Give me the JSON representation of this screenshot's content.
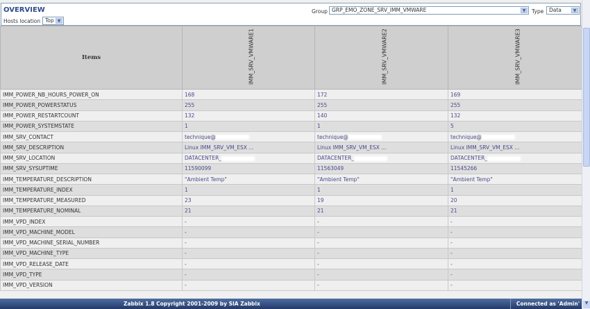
{
  "header": {
    "title": "OVERVIEW",
    "hosts_location_label": "Hosts location",
    "hosts_location_value": "Top",
    "group_label": "Group",
    "group_value": "GRP_EMO_ZONE_SRV_IMM_VMWARE",
    "type_label": "Type",
    "type_value": "Data"
  },
  "table": {
    "items_header": "Items",
    "hosts": [
      "IMM_SRV_VMWARE1",
      "IMM_SRV_VMWARE2",
      "IMM_SRV_VMWARE3"
    ],
    "rows": [
      {
        "item": "IMM_POWER_NB_HOURS_POWER_ON",
        "values": [
          "168",
          "172",
          "169"
        ]
      },
      {
        "item": "IMM_POWER_POWERSTATUS",
        "values": [
          "255",
          "255",
          "255"
        ]
      },
      {
        "item": "IMM_POWER_RESTARTCOUNT",
        "values": [
          "132",
          "140",
          "132"
        ]
      },
      {
        "item": "IMM_POWER_SYSTEMSTATE",
        "values": [
          "1",
          "1",
          "5"
        ]
      },
      {
        "item": "IMM_SRV_CONTACT",
        "values": [
          "technique@",
          "technique@",
          "technique@"
        ],
        "redacted": true
      },
      {
        "item": "IMM_SRV_DESCRIPTION",
        "values": [
          "Linux IMM_SRV_VM_ESX ...",
          "Linux IMM_SRV_VM_ESX ...",
          "Linux IMM_SRV_VM_ESX ..."
        ]
      },
      {
        "item": "IMM_SRV_LOCATION",
        "values": [
          "DATACENTER_",
          "DATACENTER_",
          "DATACENTER_"
        ],
        "redacted": true
      },
      {
        "item": "IMM_SRV_SYSUPTIME",
        "values": [
          "11590099",
          "11563049",
          "11545266"
        ]
      },
      {
        "item": "IMM_TEMPERATURE_DESCRIPTION",
        "values": [
          "\"Ambient Temp\"",
          "\"Ambient Temp\"",
          "\"Ambient Temp\""
        ]
      },
      {
        "item": "IMM_TEMPERATURE_INDEX",
        "values": [
          "1",
          "1",
          "1"
        ]
      },
      {
        "item": "IMM_TEMPERATURE_MEASURED",
        "values": [
          "23",
          "19",
          "20"
        ]
      },
      {
        "item": "IMM_TEMPERATURE_NOMINAL",
        "values": [
          "21",
          "21",
          "21"
        ]
      },
      {
        "item": "IMM_VPD_INDEX",
        "values": [
          "-",
          "-",
          "-"
        ]
      },
      {
        "item": "IMM_VPD_MACHINE_MODEL",
        "values": [
          "-",
          "-",
          "-"
        ]
      },
      {
        "item": "IMM_VPD_MACHINE_SERIAL_NUMBER",
        "values": [
          "-",
          "-",
          "-"
        ]
      },
      {
        "item": "IMM_VPD_MACHINE_TYPE",
        "values": [
          "-",
          "-",
          "-"
        ]
      },
      {
        "item": "IMM_VPD_RELEASE_DATE",
        "values": [
          "-",
          "-",
          "-"
        ]
      },
      {
        "item": "IMM_VPD_TYPE",
        "values": [
          "-",
          "-",
          "-"
        ]
      },
      {
        "item": "IMM_VPD_VERSION",
        "values": [
          "-",
          "-",
          "-"
        ]
      }
    ]
  },
  "footer": {
    "copyright": "Zabbix 1.8 Copyright 2001-2009 by SIA Zabbix",
    "connected": "Connected as 'Admin'"
  }
}
